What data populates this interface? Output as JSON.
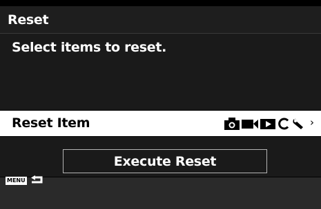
{
  "title": "Reset",
  "description": "Select items to reset.",
  "reset_item": {
    "label": "Reset Item",
    "icons": [
      "camera-icon",
      "movie-icon",
      "playback-icon",
      "custom-c-icon",
      "wrench-icon"
    ],
    "chevron": "›"
  },
  "execute_button": {
    "label": "Execute Reset"
  },
  "footer": {
    "menu_key": "MENU",
    "back_icon": "return-arrow-icon"
  }
}
